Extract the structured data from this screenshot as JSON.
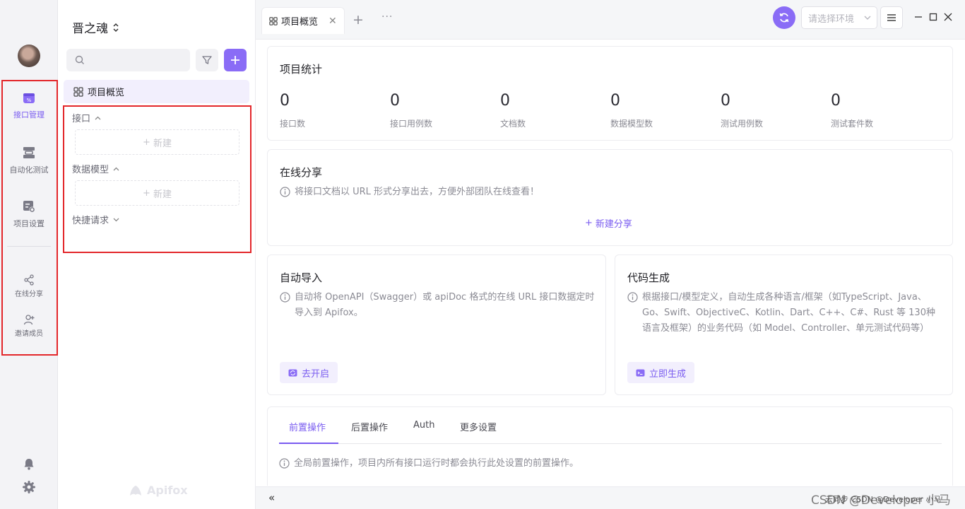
{
  "rail": {
    "items": [
      {
        "label": "接口管理",
        "icon": "api-management-icon",
        "active": true
      },
      {
        "label": "自动化测试",
        "icon": "automation-test-icon",
        "active": false
      },
      {
        "label": "项目设置",
        "icon": "project-settings-icon",
        "active": false
      }
    ],
    "share_label": "在线分享",
    "invite_label": "邀请成员",
    "accent": "#7a5cf0",
    "highlight_color": "#e3262a"
  },
  "panel": {
    "project_name": "晋之魂",
    "overview_label": "项目概览",
    "tree": [
      {
        "title": "接口",
        "new_label": "新建",
        "expanded": true
      },
      {
        "title": "数据模型",
        "new_label": "新建",
        "expanded": true
      },
      {
        "title": "快捷请求",
        "expanded": false
      }
    ],
    "brand": "Apifox"
  },
  "topbar": {
    "tab_label": "项目概览",
    "env_placeholder": "请选择环境"
  },
  "stats": {
    "title": "项目统计",
    "items": [
      {
        "value": "0",
        "label": "接口数"
      },
      {
        "value": "0",
        "label": "接口用例数"
      },
      {
        "value": "0",
        "label": "文档数"
      },
      {
        "value": "0",
        "label": "数据模型数"
      },
      {
        "value": "0",
        "label": "测试用例数"
      },
      {
        "value": "0",
        "label": "测试套件数"
      }
    ]
  },
  "share": {
    "title": "在线分享",
    "desc": "将接口文档以 URL 形式分享出去，方便外部团队在线查看！",
    "new_label": "新建分享"
  },
  "import": {
    "title": "自动导入",
    "desc": "自动将 OpenAPI（Swagger）或 apiDoc 格式的在线 URL 接口数据定时导入到 Apifox。",
    "button": "去开启"
  },
  "codegen": {
    "title": "代码生成",
    "desc": "根据接口/模型定义，自动生成各种语言/框架（如TypeScript、Java、Go、Swift、ObjectiveC、Kotlin、Dart、C++、C#、Rust 等 130种语言及框架）的业务代码（如 Model、Controller、单元测试代码等）",
    "button": "立即生成"
  },
  "settings_tabs": {
    "tabs": [
      "前置操作",
      "后置操作",
      "Auth",
      "更多设置"
    ],
    "active": 0,
    "desc": "全局前置操作，项目内所有接口运行时都会执行此处设置的前置操作。"
  },
  "bottom": {
    "collapse": "«",
    "watermark": "CSDN @Developer 小马",
    "watermark2": "云同步 CSDN @Developer 小马"
  }
}
